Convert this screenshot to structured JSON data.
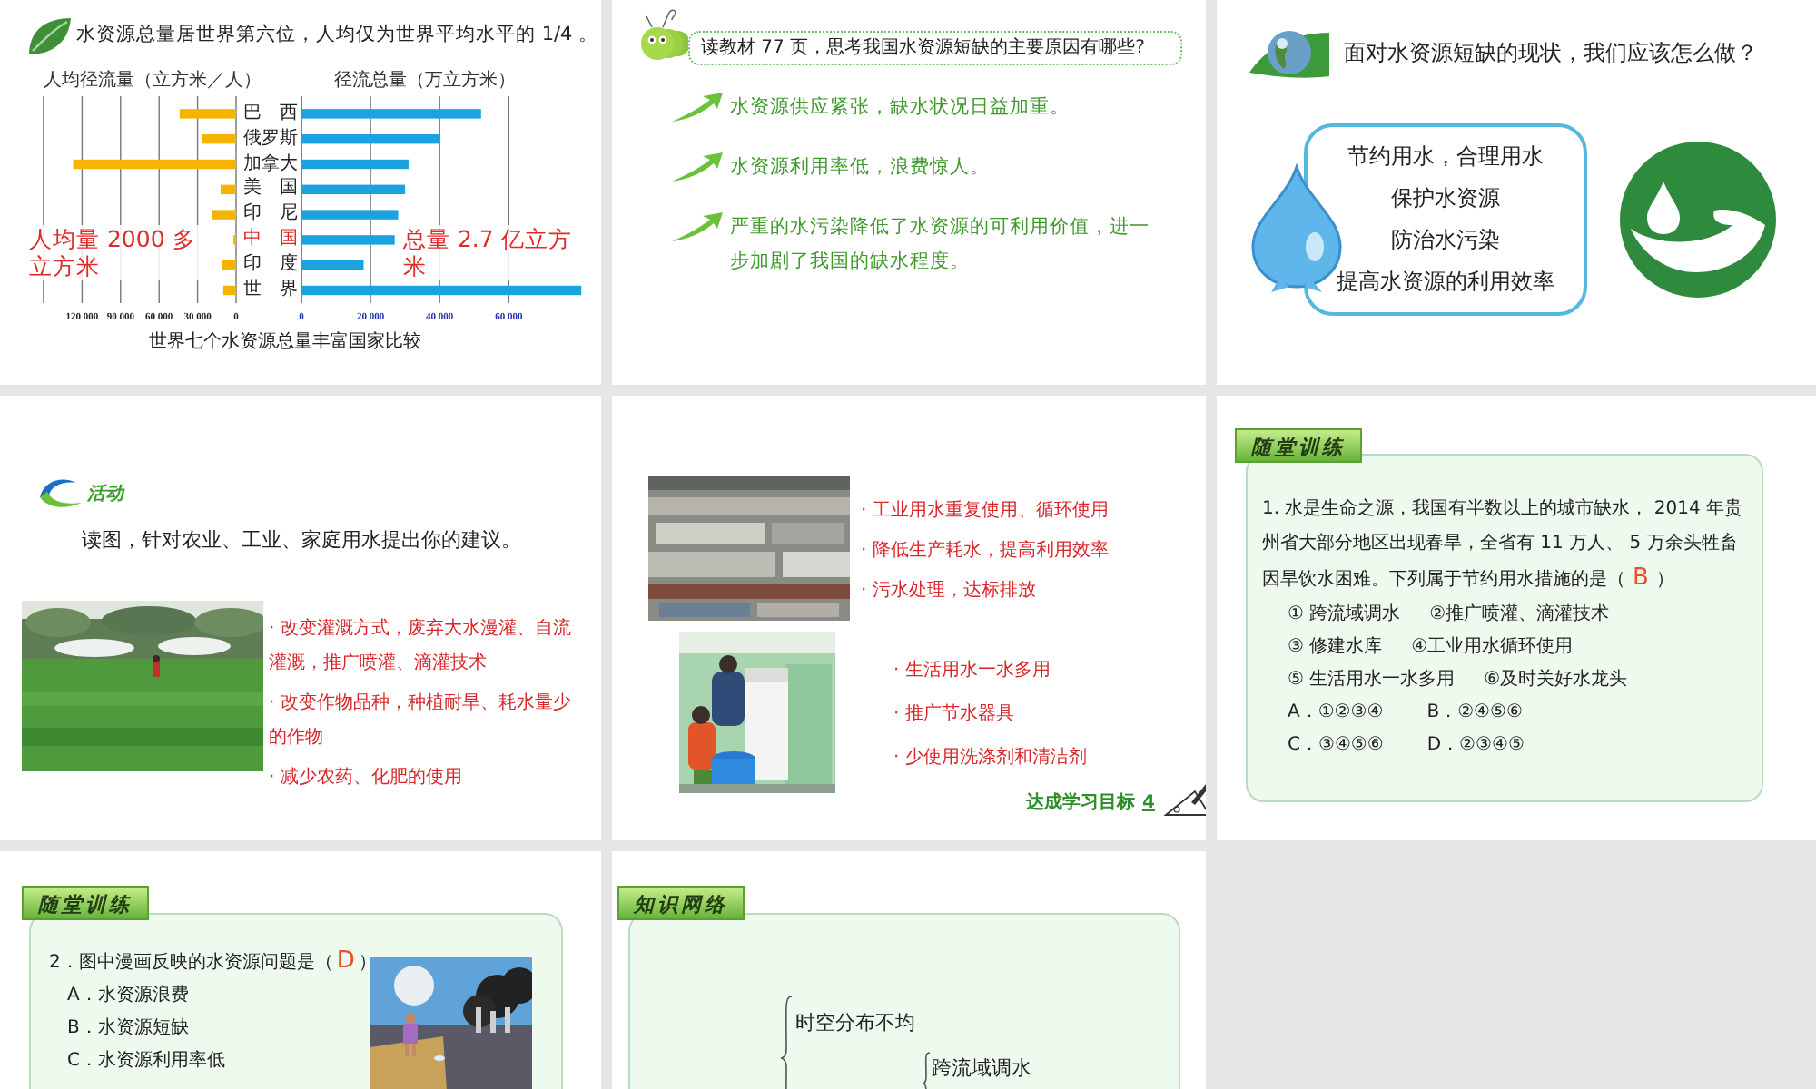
{
  "slides": [
    {
      "kind": "chart",
      "title": "水资源总量居世界第六位，人均仅为世界平均水平的 1/4 。",
      "left_chart": {
        "chart_data": {
          "type": "bar",
          "orientation": "horizontal",
          "title": "人均径流量（立方米／人）",
          "xlim": [
            150000,
            0
          ],
          "grid": true,
          "series": [
            {
              "color": "#f5b400",
              "values": [
                44000,
                27000,
                127000,
                12000,
                19000,
                2000,
                11000,
                10000
              ]
            }
          ],
          "xticks": [
            {
              "value": 120000,
              "label": "120 000"
            },
            {
              "value": 90000,
              "label": "90 000"
            },
            {
              "value": 60000,
              "label": "60 000"
            },
            {
              "value": 30000,
              "label": "30 000"
            },
            0
          ]
        }
      },
      "country_labels": [
        {
          "label": "巴　西",
          "highlighted": false
        },
        {
          "label": "俄罗斯",
          "highlighted": false
        },
        {
          "label": "加拿大",
          "highlighted": false
        },
        {
          "label": "美　国",
          "highlighted": false
        },
        {
          "label": "印　尼",
          "highlighted": false
        },
        {
          "label": "中　国",
          "highlighted": true
        },
        {
          "label": "印　度",
          "highlighted": false
        },
        {
          "label": "世　界",
          "highlighted": false
        }
      ],
      "right_chart": {
        "chart_data": {
          "type": "bar",
          "orientation": "horizontal",
          "title": "径流总量（万立方米）",
          "xlim": [
            0,
            82000
          ],
          "grid": true,
          "series": [
            {
              "color": "#1aa3e0",
              "values": [
                52000,
                40000,
                31000,
                30000,
                28000,
                27000,
                18000,
                81000
              ]
            }
          ],
          "xticks": [
            0,
            {
              "value": 20000,
              "label": "20 000"
            },
            {
              "value": 40000,
              "label": "40 000"
            },
            {
              "value": 60000,
              "label": "60 000"
            }
          ]
        }
      },
      "annotations": [
        "人均量 2000 多立方米",
        "总量 2.7 亿立方米"
      ],
      "caption": "世界七个水资源总量丰富国家比较"
    },
    {
      "kind": "reasons",
      "question": "读教材 77 页，思考我国水资源短缺的主要原因有哪些?",
      "reasons": [
        "水资源供应紧张，缺水状况日益加重。",
        "水资源利用率低，浪费惊人。",
        "严重的水污染降低了水资源的可利用价值，进一步加剧了我国的缺水程度。"
      ]
    },
    {
      "kind": "measures",
      "title": "面对水资源短缺的现状，我们应该怎么做？",
      "measures": [
        "节约用水，合理用水",
        "保护水资源",
        "防治水污染",
        "提高水资源的利用效率"
      ]
    },
    {
      "kind": "activity",
      "label": "活动",
      "prompt": "读图，针对农业、工业、家庭用水提出你的建议。",
      "suggestions": [
        "· 改变灌溉方式，废弃大水漫灌、自流灌溉，推广喷灌、滴灌技术",
        "· 改变作物品种，种植耐旱、耗水量少的作物",
        "· 减少农药、化肥的使用"
      ]
    },
    {
      "kind": "suggestions",
      "industry": [
        "· 工业用水重复使用、循环使用",
        "· 降低生产耗水，提高利用效率",
        "· 污水处理，达标排放"
      ],
      "household": [
        "· 生活用水一水多用",
        "· 推广节水器具",
        "· 少使用洗涤剂和清洁剂"
      ],
      "footer": "达成学习目标",
      "footer_number": "4"
    },
    {
      "kind": "exercise",
      "tag": "随堂训练",
      "question": "1.  水是生命之源，我国有半数以上的城市缺水， 2014 年贵州省大部分地区出现春旱，全省有 11 万人、 5 万余头牲畜因旱饮水困难。下列属于节约用水措施的是（",
      "answer": "B",
      "question_end": "）",
      "option_rows": [
        [
          "① 跨流域调水",
          "②推广喷灌、滴灌技术"
        ],
        [
          "③ 修建水库",
          "④工业用水循环使用"
        ],
        [
          "⑤ 生活用水一水多用",
          "⑥及时关好水龙头"
        ]
      ],
      "choice_rows": [
        [
          "A．①②③④",
          "B．②④⑤⑥"
        ],
        [
          "C．③④⑤⑥",
          "D．②③④⑤"
        ]
      ]
    },
    {
      "kind": "exercise_picture",
      "tag": "随堂训练",
      "question": "2．图中漫画反映的水资源问题是（",
      "answer": "D",
      "question_end": "）",
      "choices": [
        "A．水资源浪费",
        "B．水资源短缺",
        "C．水资源利用率低"
      ]
    },
    {
      "kind": "knowledge_map",
      "tag": "知识网络",
      "map": {
        "children": [
          {
            "label": "时空分布不均"
          },
          {
            "children": [
              {
                "label": "跨流域调水"
              }
            ]
          }
        ]
      }
    }
  ]
}
